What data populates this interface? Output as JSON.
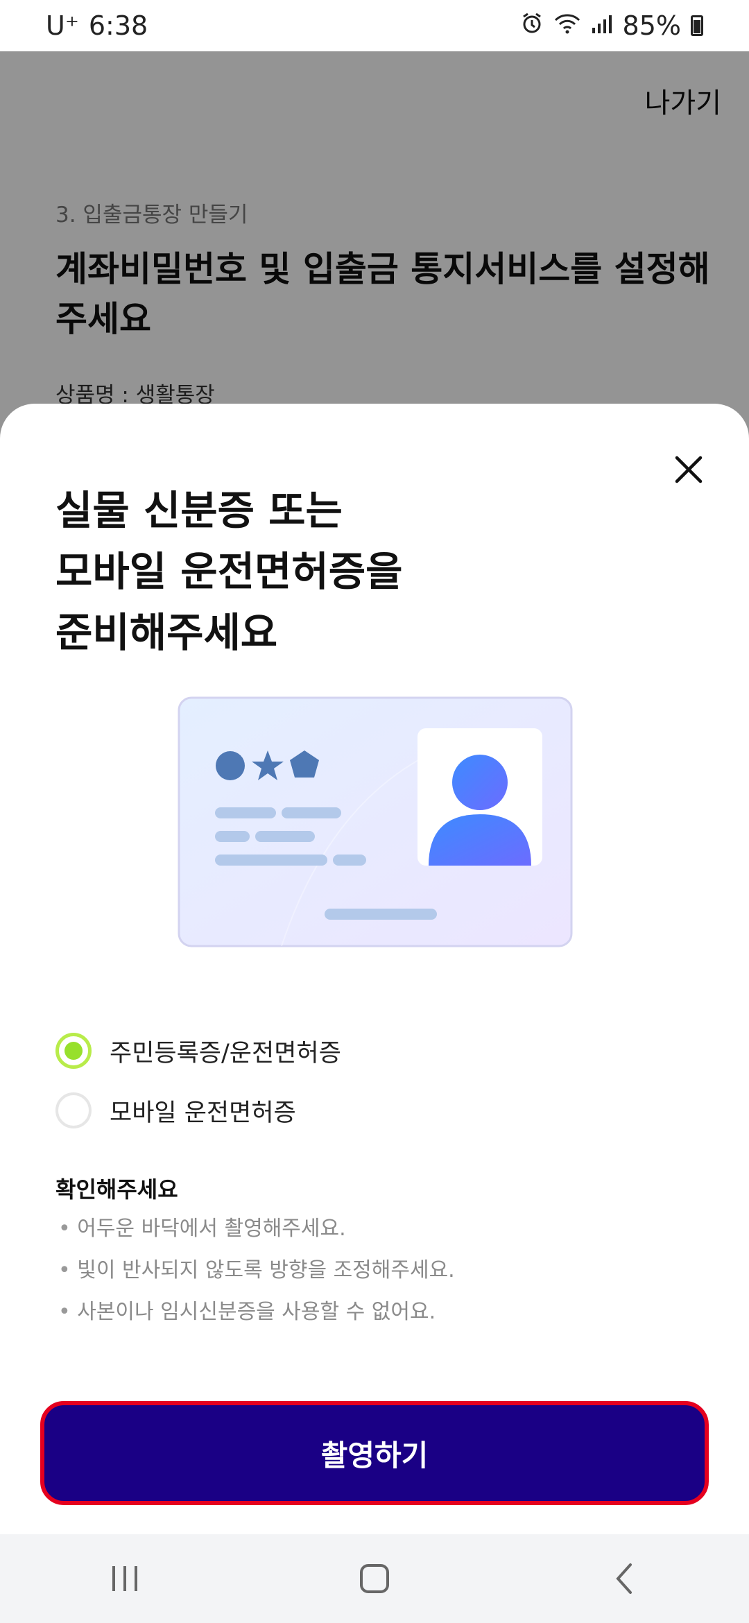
{
  "status_bar": {
    "carrier": "U⁺",
    "time": "6:38",
    "battery": "85%",
    "icons": [
      "alarm-icon",
      "wifi-icon",
      "signal-icon",
      "battery-icon"
    ]
  },
  "background_page": {
    "exit_label": "나가기",
    "step": "3. 입출금통장 만들기",
    "title": "계좌비밀번호 및 입출금 통지서비스를 설정해주세요",
    "product": "상품명 : 생활통장"
  },
  "sheet": {
    "title_lines": [
      "실물 신분증 또는",
      "모바일 운전면허증을",
      "준비해주세요"
    ],
    "options": [
      {
        "label": "주민등록증/운전면허증",
        "selected": true
      },
      {
        "label": "모바일 운전면허증",
        "selected": false
      }
    ],
    "notice_title": "확인해주세요",
    "notices": [
      "어두운 바닥에서 촬영해주세요.",
      "빛이 반사되지 않도록 방향을 조정해주세요.",
      "사본이나 임시신분증을 사용할 수 없어요."
    ],
    "capture_label": "촬영하기"
  },
  "colors": {
    "primary_button": "#1a0085",
    "button_highlight_border": "#e5001f",
    "radio_selected": "#97e02c"
  },
  "nav_bar": [
    "recent-apps-icon",
    "home-icon",
    "back-icon"
  ]
}
